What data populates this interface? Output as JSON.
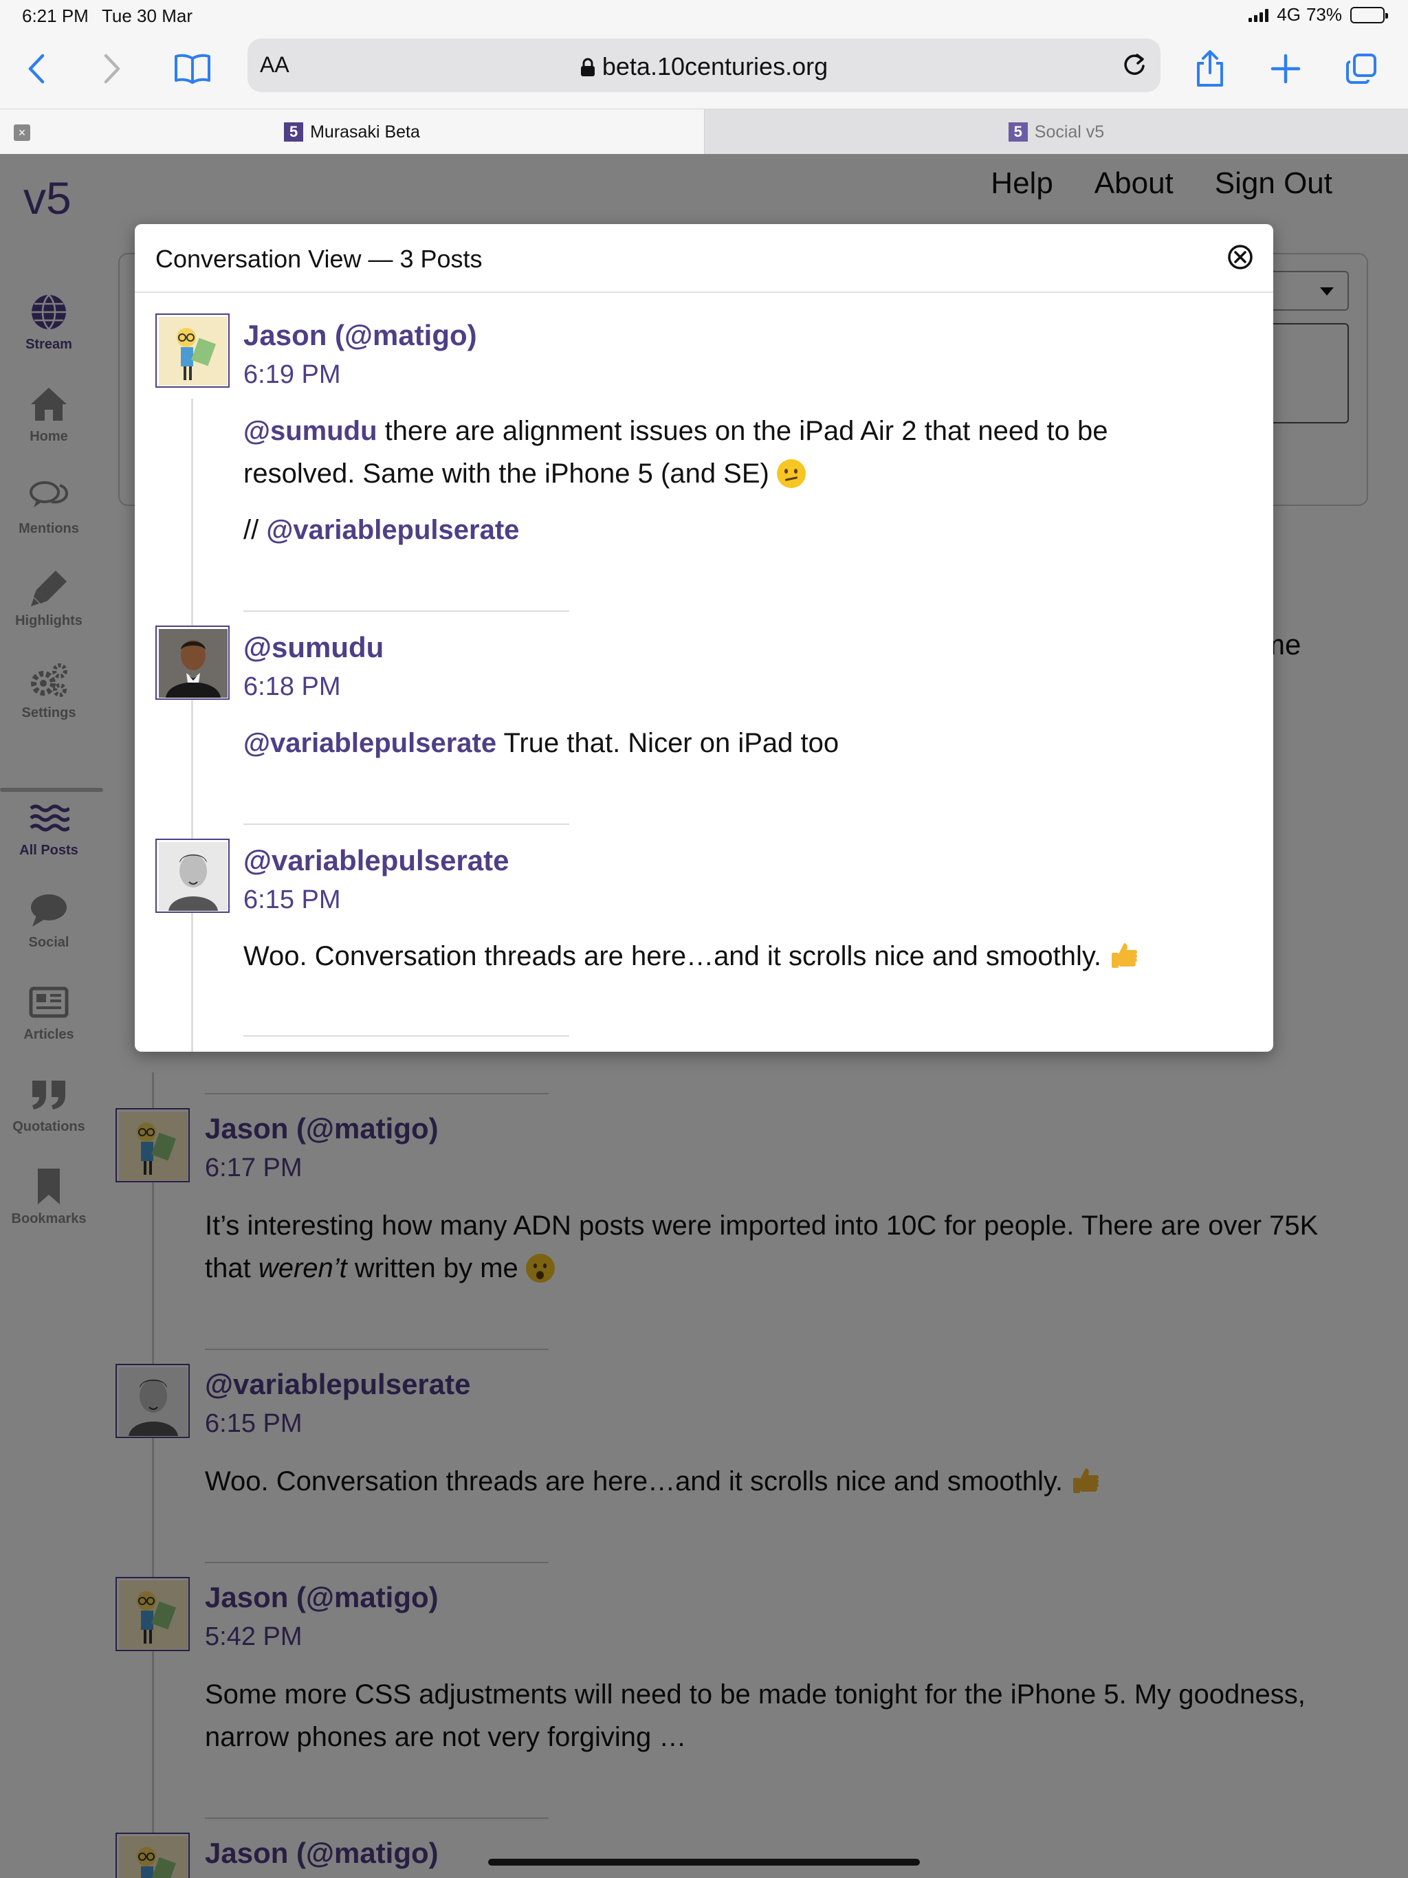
{
  "status_bar": {
    "time": "6:21 PM",
    "date": "Tue 30 Mar",
    "network": "4G",
    "battery": "73%",
    "battery_level": 0.73
  },
  "toolbar": {
    "text_size_label": "AA",
    "url": "beta.10centuries.org"
  },
  "tabs": [
    {
      "label": "Murasaki Beta",
      "favicon": "5",
      "active": true
    },
    {
      "label": "Social v5",
      "favicon": "5",
      "active": false
    }
  ],
  "site": {
    "logo": "v5",
    "nav": [
      "Help",
      "About",
      "Sign Out"
    ],
    "sidebar": [
      {
        "label": "Stream",
        "icon": "globe-icon",
        "active": true
      },
      {
        "label": "Home",
        "icon": "home-icon",
        "active": false
      },
      {
        "label": "Mentions",
        "icon": "mentions-icon",
        "active": false
      },
      {
        "label": "Highlights",
        "icon": "highlighter-icon",
        "active": false
      },
      {
        "label": "Settings",
        "icon": "gears-icon",
        "active": false
      },
      {
        "label": "All Posts",
        "icon": "waves-icon",
        "active": true
      },
      {
        "label": "Social",
        "icon": "chat-bubble-icon",
        "active": false
      },
      {
        "label": "Articles",
        "icon": "newspaper-icon",
        "active": false
      },
      {
        "label": "Quotations",
        "icon": "quote-icon",
        "active": false
      },
      {
        "label": "Bookmarks",
        "icon": "bookmark-icon",
        "active": false
      }
    ],
    "partial_text": "me"
  },
  "modal": {
    "title": "Conversation View — 3 Posts",
    "posts": [
      {
        "author": "Jason (@matigo)",
        "time": "6:19 PM",
        "mention": "@sumudu",
        "text": " there are alignment issues on the iPad Air 2 that need to be resolved. Same with the iPhone 5 (and SE) ",
        "cc_prefix": "// ",
        "cc_mention": "@variablepulserate"
      },
      {
        "author": "@sumudu",
        "time": "6:18 PM",
        "mention": "@variablepulserate",
        "text": " True that. Nicer on iPad too"
      },
      {
        "author": "@variablepulserate",
        "time": "6:15 PM",
        "text": "Woo. Conversation threads are here…and it scrolls nice and smoothly. "
      }
    ]
  },
  "stream_posts": [
    {
      "author": "Jason (@matigo)",
      "time": "6:17 PM",
      "text_before": "It’s interesting how many ADN posts were imported into 10C for people. There are over 75K that ",
      "text_em": "weren’t",
      "text_after": " written by me "
    },
    {
      "author": "@variablepulserate",
      "time": "6:15 PM",
      "text": "Woo. Conversation threads are here…and it scrolls nice and smoothly. "
    },
    {
      "author": "Jason (@matigo)",
      "time": "5:42 PM",
      "text": "Some more CSS adjustments will need to be made tonight for the iPhone 5. My goodness, narrow phones are not very forgiving …"
    },
    {
      "author": "Jason (@matigo)"
    }
  ]
}
